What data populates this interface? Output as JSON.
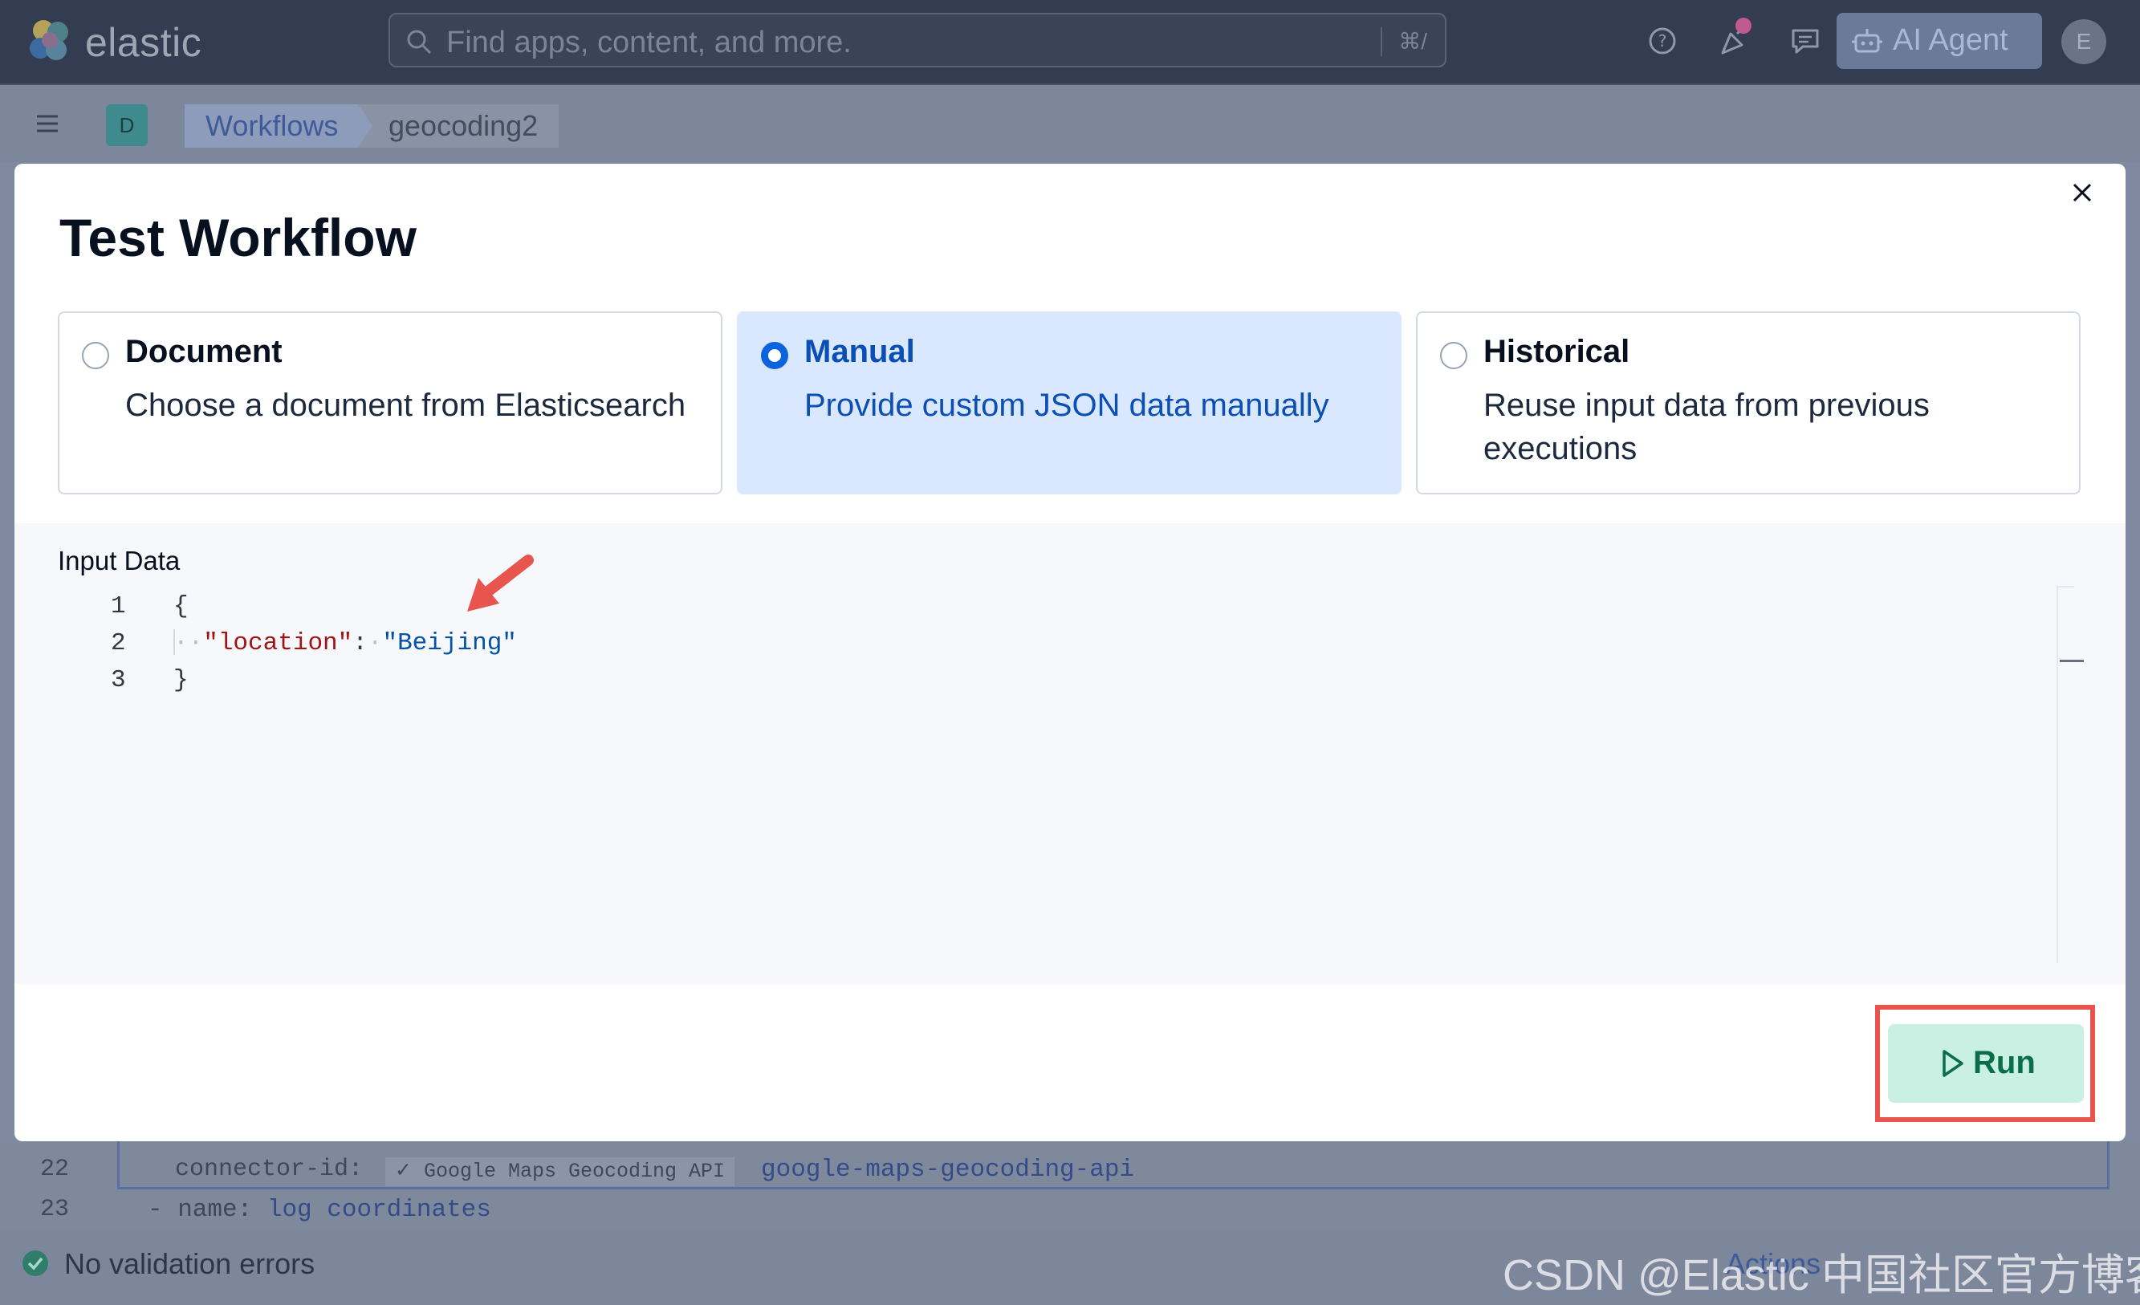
{
  "app": {
    "logo_text": "elastic",
    "search_placeholder": "Find apps, content, and more.",
    "search_shortcut": "⌘/",
    "ai_agent_label": "AI Agent",
    "avatar_initial": "E"
  },
  "breadcrumb": {
    "space_initial": "D",
    "items": [
      "Workflows",
      "geocoding2"
    ]
  },
  "modal": {
    "title": "Test Workflow",
    "options": [
      {
        "title": "Document",
        "description": "Choose a document from Elasticsearch",
        "selected": false
      },
      {
        "title": "Manual",
        "description": "Provide custom JSON data manually",
        "selected": true
      },
      {
        "title": "Historical",
        "description": "Reuse input data from previous executions",
        "selected": false
      }
    ],
    "input_label": "Input Data",
    "code_lines": {
      "line_numbers": [
        "1",
        "2",
        "3"
      ],
      "open_brace": "{",
      "key": "\"location\"",
      "colon": ":",
      "value": "\"Beijing\"",
      "close_brace": "}"
    },
    "run_label": "Run"
  },
  "background_editor": {
    "line_22_number": "22",
    "line_22_key": "connector-id:",
    "line_22_check": "✓ Google Maps Geocoding API",
    "line_22_value": "google-maps-geocoding-api",
    "line_23_number": "23",
    "line_23_key": "- name:",
    "line_23_value": "log coordinates"
  },
  "status": {
    "validation_text": "No validation errors",
    "right_partial": "Actions"
  },
  "watermark": "CSDN @Elastic 中国社区官方博客",
  "colors": {
    "accent": "#0b64dd",
    "selected_card_bg": "#d9e8ff",
    "run_button_bg": "#c9f0e2",
    "highlight": "#e8554e"
  },
  "icons": [
    "elastic-logo",
    "search-icon",
    "help-icon",
    "news-icon",
    "chat-icon",
    "robot-icon",
    "menu-icon",
    "close-icon",
    "play-icon",
    "check-circle-icon",
    "arrow-annotation"
  ]
}
